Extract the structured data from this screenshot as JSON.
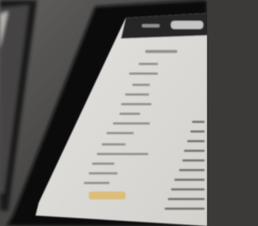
{
  "scene": {
    "description_type": "photo",
    "colors": {
      "background": "#4a4947",
      "device_frame": "#141414",
      "screen": "#f4f2ee",
      "text_lines": "#9c9a96",
      "highlight_button": "#e8c77a",
      "header_bar": "#2a2a2a"
    }
  },
  "left_device": {
    "icon": "tablet-icon"
  },
  "right_device": {
    "icon": "tablet-icon"
  }
}
